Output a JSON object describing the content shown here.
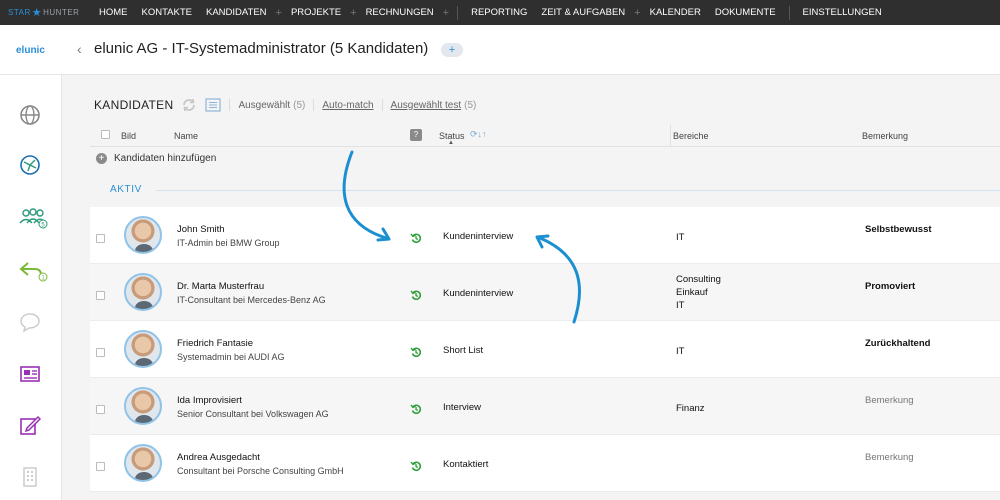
{
  "app": {
    "logo_star": "STAR",
    "logo_hunter": "HUNTER"
  },
  "nav": [
    {
      "label": "HOME",
      "plus": false
    },
    {
      "label": "KONTAKTE",
      "plus": false
    },
    {
      "label": "KANDIDATEN",
      "plus": true
    },
    {
      "label": "PROJEKTE",
      "plus": true
    },
    {
      "label": "RECHNUNGEN",
      "plus": true
    },
    {
      "label": "REPORTING",
      "plus": false
    },
    {
      "label": "ZEIT & AUFGABEN",
      "plus": true
    },
    {
      "label": "KALENDER",
      "plus": false
    },
    {
      "label": "DOKUMENTE",
      "plus": false
    },
    {
      "label": "EINSTELLUNGEN",
      "plus": false
    }
  ],
  "header": {
    "brand": "elunic",
    "title": "elunic AG - IT-Systemadministrator (5 Kandidaten)",
    "add_label": "+"
  },
  "toolbar": {
    "title": "KANDIDATEN",
    "selected": "Ausgewählt",
    "selected_count": "(5)",
    "automatch": "Auto-match",
    "selected_test": "Ausgewählt test",
    "selected_test_count": "(5)"
  },
  "columns": {
    "bild": "Bild",
    "name": "Name",
    "help": "?",
    "status": "Status",
    "bereiche": "Bereiche",
    "bemerkung": "Bemerkung"
  },
  "add_candidates": "Kandidaten hinzufügen",
  "section": "AKTIV",
  "candidates": [
    {
      "name": "John Smith",
      "sub": "IT-Admin bei BMW Group",
      "status": "Kundeninterview",
      "bereiche": "IT",
      "bemerkung": "Selbstbewusst",
      "placeholder": false
    },
    {
      "name": "Dr. Marta Musterfrau",
      "sub": "IT-Consultant bei Mercedes-Benz AG",
      "status": "Kundeninterview",
      "bereiche": "Consulting\nEinkauf\nIT",
      "bemerkung": "Promoviert",
      "placeholder": false
    },
    {
      "name": "Friedrich Fantasie",
      "sub": "Systemadmin bei AUDI AG",
      "status": "Short List",
      "bereiche": "IT",
      "bemerkung": "Zurückhaltend",
      "placeholder": false
    },
    {
      "name": "Ida Improvisiert",
      "sub": "Senior Consultant bei Volkswagen AG",
      "status": "Interview",
      "bereiche": "Finanz",
      "bemerkung": "Bemerkung",
      "placeholder": true
    },
    {
      "name": "Andrea Ausgedacht",
      "sub": "Consultant bei Porsche Consulting GmbH",
      "status": "Kontaktiert",
      "bereiche": "",
      "bemerkung": "Bemerkung",
      "placeholder": true
    }
  ],
  "colors": {
    "accent": "#2a8fd6",
    "status_icon": "#2e9e3a",
    "nav_bg": "#2f2f2f"
  },
  "icons": {
    "sidebar": [
      "globe-icon",
      "network-icon",
      "team-icon",
      "reply-icon",
      "chat-icon",
      "newspaper-icon",
      "edit-icon",
      "building-icon"
    ],
    "row": "history-icon",
    "toolbar": [
      "refresh-icon",
      "list-icon"
    ]
  },
  "badges": {
    "team": "5",
    "reply": "1"
  }
}
